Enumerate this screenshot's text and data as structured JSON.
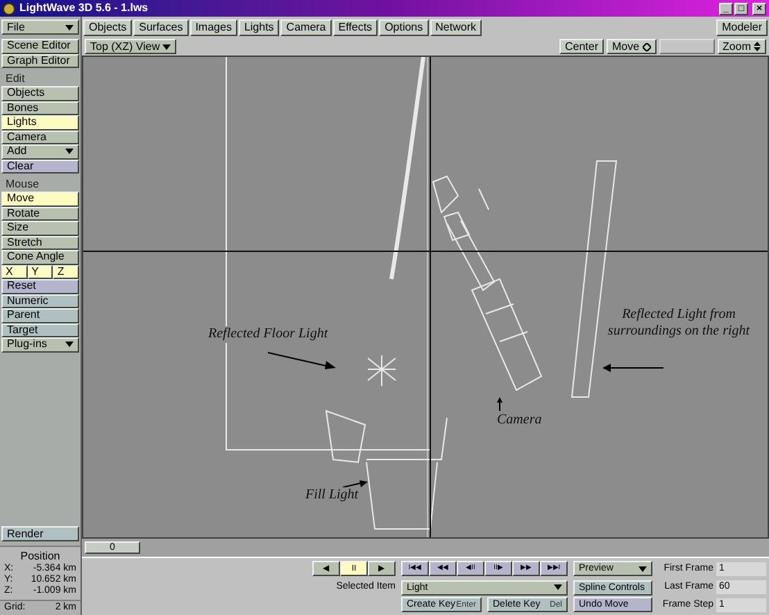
{
  "window": {
    "title": "LightWave 3D 5.6 - 1.lws",
    "controls": [
      "_",
      "□",
      "×"
    ]
  },
  "menu": {
    "file": "File",
    "tabs": [
      {
        "label": "Objects"
      },
      {
        "label": "Surfaces"
      },
      {
        "label": "Images"
      },
      {
        "label": "Lights"
      },
      {
        "label": "Camera"
      },
      {
        "label": "Effects"
      },
      {
        "label": "Options"
      },
      {
        "label": "Network"
      }
    ],
    "modeler": "Modeler"
  },
  "sidebar": {
    "items": [
      {
        "kind": "button",
        "label": "Scene Editor",
        "selected": false
      },
      {
        "kind": "button",
        "label": "Graph Editor",
        "selected": false
      },
      {
        "kind": "label",
        "label": "Edit"
      },
      {
        "kind": "button",
        "label": "Objects",
        "selected": false
      },
      {
        "kind": "button",
        "label": "Bones",
        "selected": false
      },
      {
        "kind": "button",
        "label": "Lights",
        "selected": true
      },
      {
        "kind": "button",
        "label": "Camera",
        "selected": false
      },
      {
        "kind": "dropdown",
        "label": "Add"
      },
      {
        "kind": "action",
        "label": "Clear"
      },
      {
        "kind": "label",
        "label": "Mouse"
      },
      {
        "kind": "button",
        "label": "Move",
        "selected": true
      },
      {
        "kind": "button",
        "label": "Rotate",
        "selected": false
      },
      {
        "kind": "button",
        "label": "Size",
        "selected": false
      },
      {
        "kind": "button",
        "label": "Stretch",
        "selected": false
      },
      {
        "kind": "button",
        "label": "Cone Angle",
        "selected": false
      },
      {
        "kind": "axes",
        "labels": [
          "X",
          "Y",
          "Z"
        ]
      },
      {
        "kind": "action",
        "label": "Reset"
      },
      {
        "kind": "plain",
        "label": "Numeric"
      },
      {
        "kind": "plain",
        "label": "Parent"
      },
      {
        "kind": "plain",
        "label": "Target"
      },
      {
        "kind": "dropdown",
        "label": "Plug-ins"
      }
    ],
    "render": "Render",
    "position": {
      "title": "Position",
      "rows": [
        {
          "axis": "X:",
          "value": "-5.364 km"
        },
        {
          "axis": "Y:",
          "value": "10.652 km"
        },
        {
          "axis": "Z:",
          "value": "-1.009 km"
        }
      ]
    },
    "grid": {
      "label": "Grid:",
      "value": "2 km"
    }
  },
  "viewport": {
    "view": "Top (XZ) View",
    "buttons": [
      {
        "kind": "plain",
        "label": "Center",
        "disabled": false
      },
      {
        "kind": "mode",
        "label": "Move",
        "disabled": false
      },
      {
        "kind": "plain",
        "disabled": true
      },
      {
        "kind": "zoom",
        "label": "Zoom",
        "disabled": false
      }
    ],
    "annotations": [
      "Reflected Floor Light",
      "Fill Light",
      "Camera",
      "Reflected Light from surroundings on the right"
    ]
  },
  "timeline": {
    "frame": "0"
  },
  "controls": {
    "transport": [
      {
        "label": "◀",
        "selected": false
      },
      {
        "label": "II",
        "selected": true
      },
      {
        "label": "▶",
        "selected": false
      }
    ],
    "keys": [
      "I◀◀",
      "◀◀",
      "◀II",
      "II▶",
      "▶▶",
      "▶▶I"
    ],
    "preview": "Preview",
    "selected_item_label": "Selected Item",
    "selected_item": "Light",
    "spline": "Spline Controls",
    "create_key": {
      "label": "Create Key",
      "hint": "Enter"
    },
    "delete_key": {
      "label": "Delete Key",
      "hint": "Del"
    },
    "undo": "Undo Move",
    "frames": [
      {
        "label": "First Frame",
        "value": "1"
      },
      {
        "label": "Last Frame",
        "value": "60"
      },
      {
        "label": "Frame Step",
        "value": "1"
      }
    ]
  }
}
